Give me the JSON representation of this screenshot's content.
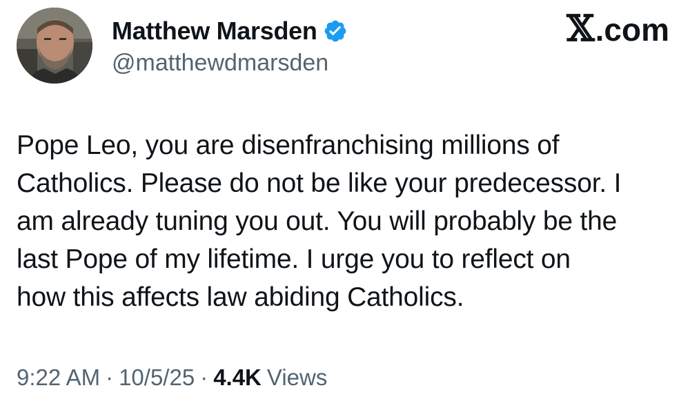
{
  "author": {
    "display_name": "Matthew Marsden",
    "handle": "@matthewdmarsden",
    "verified": true,
    "verified_color": "#1d9bf0",
    "avatar_icon": "profile-photo"
  },
  "brand": {
    "x_glyph": "𝕏",
    "domain_suffix": ".com"
  },
  "tweet": {
    "text": "Pope Leo, you are disenfranchising millions of\nCatholics. Please do not be like your predecessor. I\nam already tuning you out. You will probably be the\nlast Pope of my lifetime. I urge you to reflect on\nhow this affects law abiding Catholics."
  },
  "meta": {
    "time": "9:22 AM",
    "date": "10/5/25",
    "separator": "·",
    "views_count": "4.4K",
    "views_label": "Views"
  },
  "colors": {
    "text_primary": "#0f1419",
    "text_secondary": "#536471",
    "background": "#ffffff"
  }
}
